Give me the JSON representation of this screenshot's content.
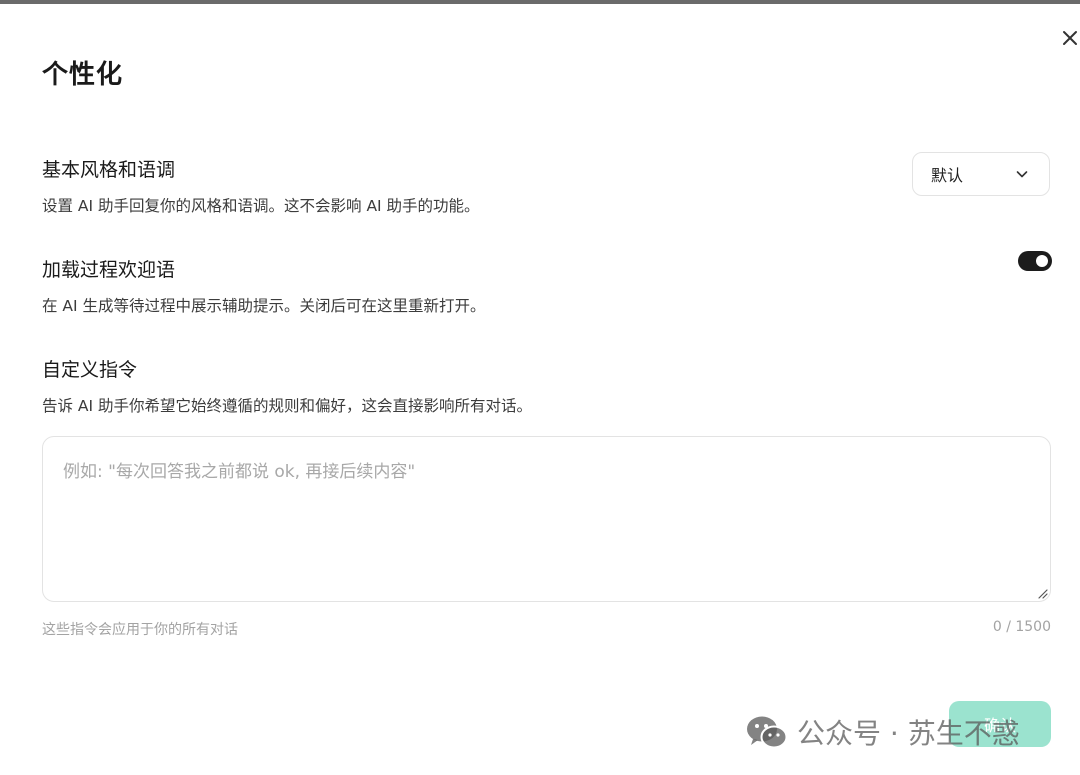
{
  "dialog": {
    "title": "个性化",
    "close_icon": "close-icon"
  },
  "style_tone": {
    "title": "基本风格和语调",
    "description": "设置 AI 助手回复你的风格和语调。这不会影响 AI 助手的功能。",
    "selected": "默认",
    "dropdown_icon": "chevron-down-icon"
  },
  "loading_greeting": {
    "title": "加载过程欢迎语",
    "description": "在 AI 生成等待过程中展示辅助提示。关闭后可在这里重新打开。",
    "enabled": true
  },
  "custom_instructions": {
    "title": "自定义指令",
    "description": "告诉 AI 助手你希望它始终遵循的规则和偏好，这会直接影响所有对话。",
    "value": "",
    "placeholder": "例如: \"每次回答我之前都说 ok, 再接后续内容\"",
    "hint": "这些指令会应用于你的所有对话",
    "counter": "0 / 1500"
  },
  "footer": {
    "confirm_label": "确认"
  },
  "watermark": {
    "text": "公众号 · 苏生不惑",
    "icon": "wechat-icon"
  },
  "colors": {
    "toggle_on": "#1c1c1c",
    "confirm_bg": "#9be3cf",
    "border": "#e3e3e3",
    "muted_text": "#a3a3a3"
  }
}
